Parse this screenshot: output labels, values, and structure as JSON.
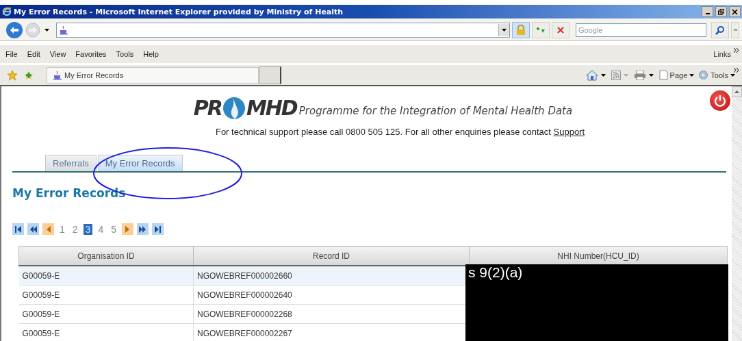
{
  "window": {
    "title": "My Error Records - Microsoft Internet Explorer provided by Ministry of Health"
  },
  "address_bar": {
    "search": {
      "placeholder": "Google"
    }
  },
  "menu_bar": {
    "items": [
      "File",
      "Edit",
      "View",
      "Favorites",
      "Tools",
      "Help"
    ],
    "links": "Links"
  },
  "command_bar": {
    "tab": "My Error Records",
    "buttons": [
      "Page",
      "Tools"
    ]
  },
  "page": {
    "logo": {
      "left": "PR",
      "right": "MHD",
      "tagline": "Programme for the Integration of Mental Health Data"
    },
    "support": {
      "text": "For technical support please call 0800 505 125. For all other enquiries please contact ",
      "link": "Support"
    },
    "tabs": [
      {
        "label": "Referrals",
        "selected": false
      },
      {
        "label": "My Error Records",
        "selected": true
      }
    ],
    "heading": "My Error Records",
    "pager": [
      {
        "label": "1",
        "selected": false
      },
      {
        "label": "2",
        "selected": false
      },
      {
        "label": "3",
        "selected": true
      },
      {
        "label": "4",
        "selected": false
      },
      {
        "label": "5",
        "selected": false
      }
    ],
    "table": {
      "columns": [
        "Organisation ID",
        "Record ID",
        "NHI Number(HCU_ID)"
      ],
      "rows": [
        [
          "G00059-E",
          "NGOWEBREF000002660"
        ],
        [
          "G00059-E",
          "NGOWEBREF000002640"
        ],
        [
          "G00059-E",
          "NGOWEBREF000002268"
        ],
        [
          "G00059-E",
          "NGOWEBREF000002267"
        ]
      ]
    },
    "redaction": "s 9(2)(a)"
  }
}
